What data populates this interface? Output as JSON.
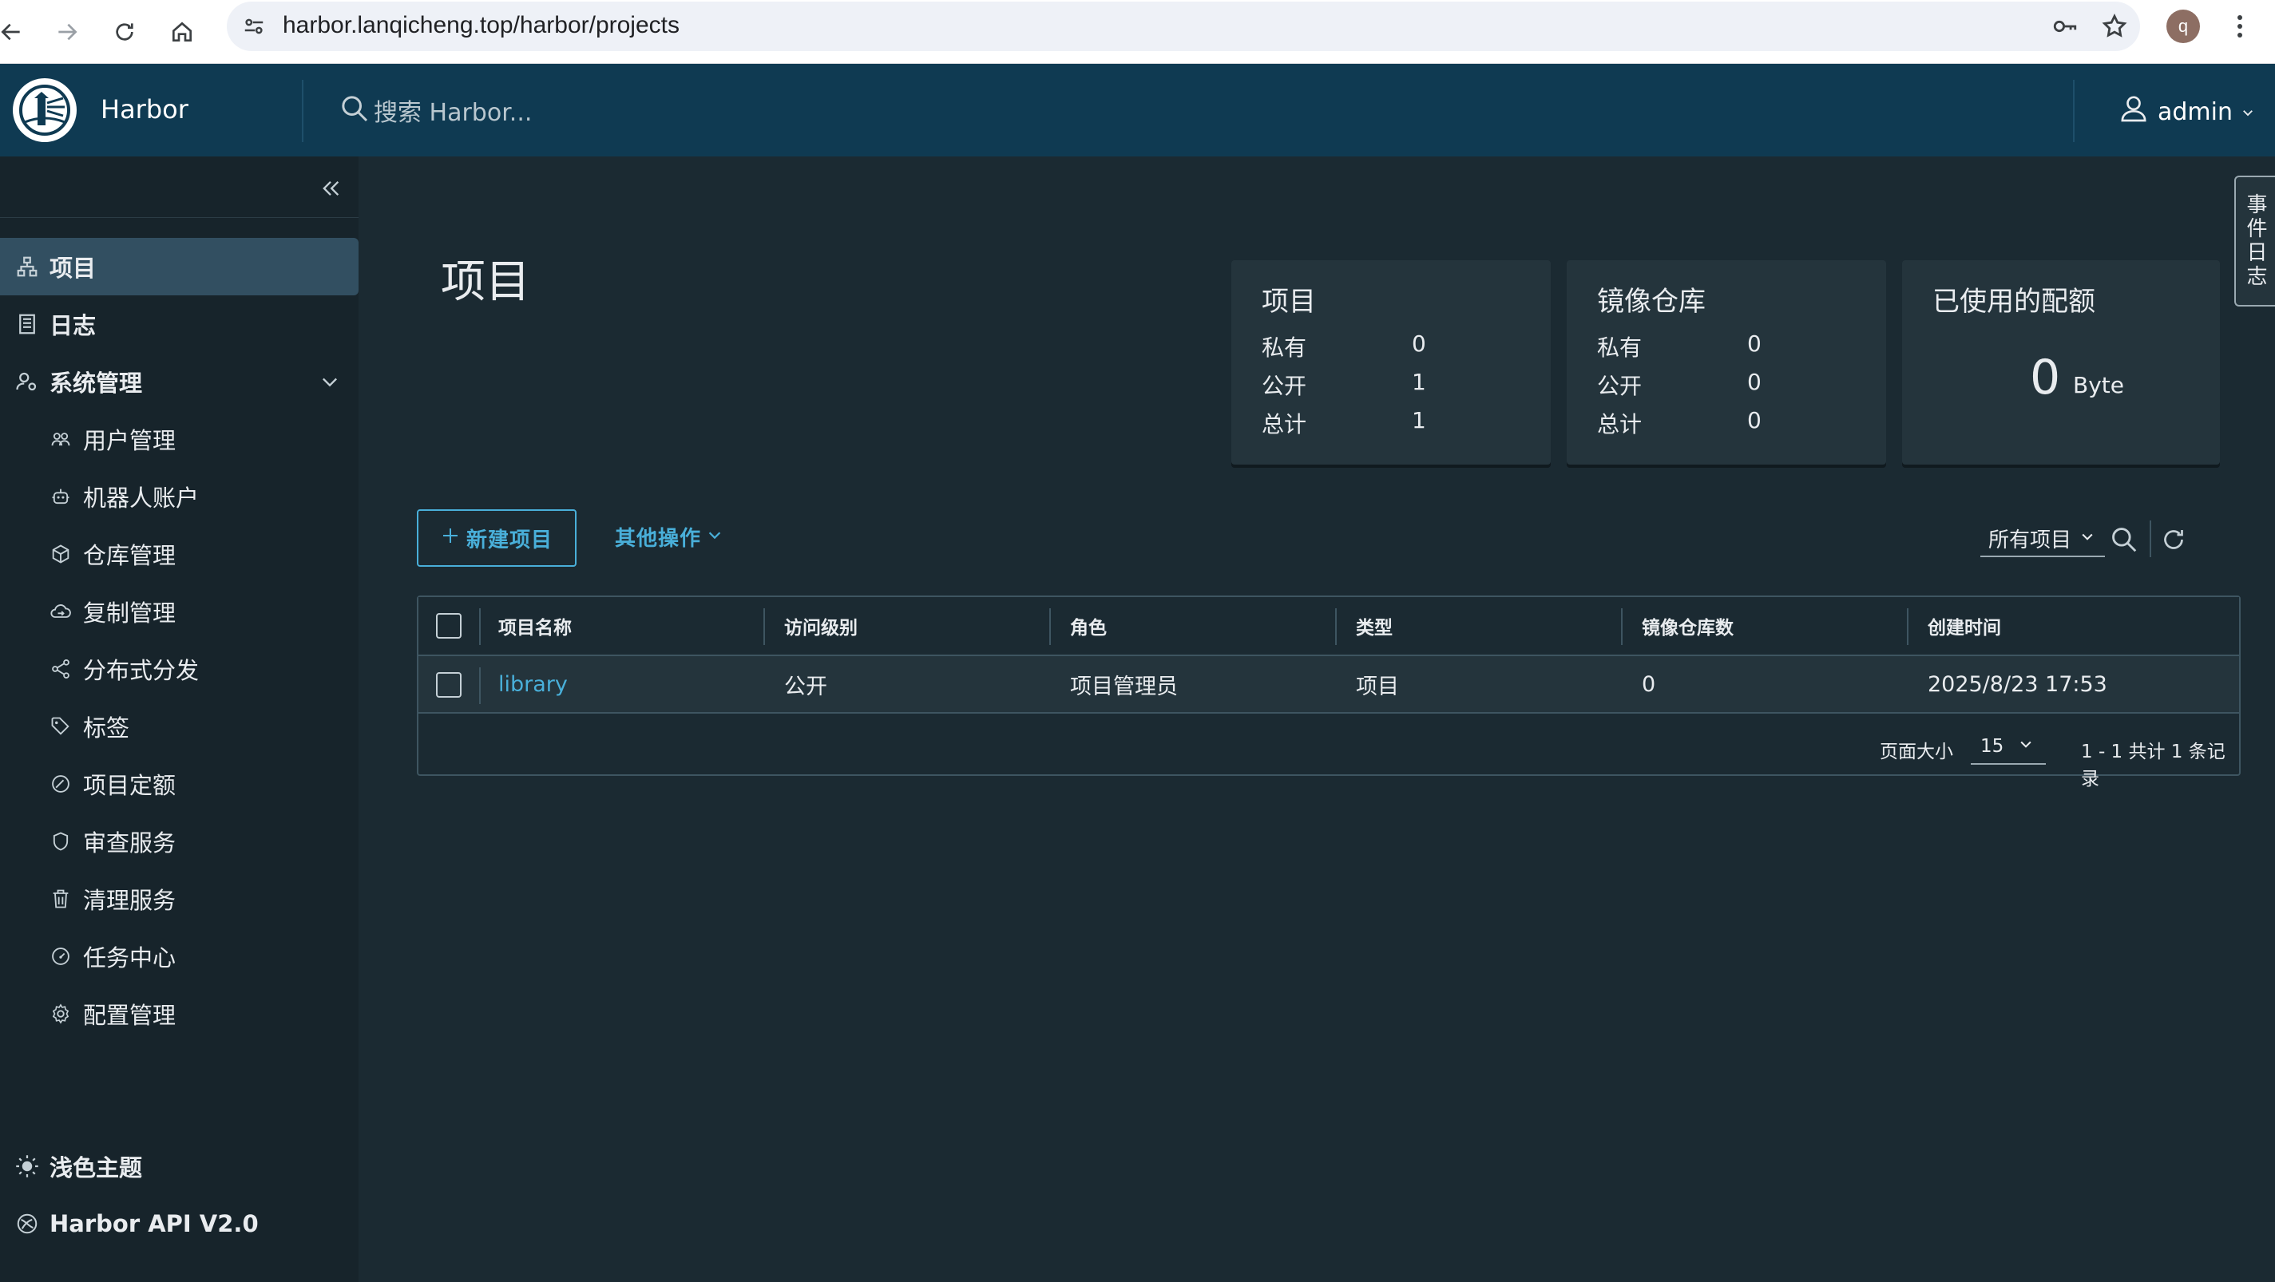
{
  "browser": {
    "url": "harbor.lanqicheng.top/harbor/projects",
    "profile_initial": "q"
  },
  "header": {
    "brand": "Harbor",
    "search_placeholder": "搜索 Harbor...",
    "user": "admin"
  },
  "sidebar": {
    "items": [
      {
        "label": "项目",
        "icon": "projects-icon",
        "active": true
      },
      {
        "label": "日志",
        "icon": "logs-icon"
      },
      {
        "label": "系统管理",
        "icon": "admin-icon"
      }
    ],
    "sub_items": [
      {
        "label": "用户管理",
        "icon": "users-icon"
      },
      {
        "label": "机器人账户",
        "icon": "robot-icon"
      },
      {
        "label": "仓库管理",
        "icon": "registry-icon"
      },
      {
        "label": "复制管理",
        "icon": "replication-icon"
      },
      {
        "label": "分布式分发",
        "icon": "share-icon"
      },
      {
        "label": "标签",
        "icon": "tag-icon"
      },
      {
        "label": "项目定额",
        "icon": "quota-icon"
      },
      {
        "label": "审查服务",
        "icon": "shield-icon"
      },
      {
        "label": "清理服务",
        "icon": "trash-icon"
      },
      {
        "label": "任务中心",
        "icon": "dashboard-icon"
      },
      {
        "label": "配置管理",
        "icon": "gear-icon"
      }
    ],
    "bottom": [
      {
        "label": "浅色主题",
        "icon": "sun-icon"
      },
      {
        "label": "Harbor API V2.0",
        "icon": "api-icon"
      }
    ]
  },
  "main": {
    "title": "项目",
    "cards": {
      "projects": {
        "title": "项目",
        "rows": [
          {
            "label": "私有",
            "value": "0"
          },
          {
            "label": "公开",
            "value": "1"
          },
          {
            "label": "总计",
            "value": "1"
          }
        ]
      },
      "repositories": {
        "title": "镜像仓库",
        "rows": [
          {
            "label": "私有",
            "value": "0"
          },
          {
            "label": "公开",
            "value": "0"
          },
          {
            "label": "总计",
            "value": "0"
          }
        ]
      },
      "quota": {
        "title": "已使用的配额",
        "value": "0",
        "unit": "Byte"
      }
    },
    "new_project_label": "新建项目",
    "more_actions_label": "其他操作",
    "filter_value": "所有项目",
    "table": {
      "columns": [
        "项目名称",
        "访问级别",
        "角色",
        "类型",
        "镜像仓库数",
        "创建时间"
      ],
      "rows": [
        {
          "name": "library",
          "access": "公开",
          "role": "项目管理员",
          "type": "项目",
          "repo_count": "0",
          "created": "2025/8/23 17:53"
        }
      ],
      "page_size_label": "页面大小",
      "page_size": "15",
      "pagination_info": "1 - 1 共计 1 条记录"
    },
    "event_log_tab": "事件日志"
  },
  "colors": {
    "accent": "#49afd9",
    "header_bg": "#0f3a52",
    "sidebar_bg": "#17242b",
    "main_bg": "#1b2a32",
    "card_bg": "#24343c"
  }
}
